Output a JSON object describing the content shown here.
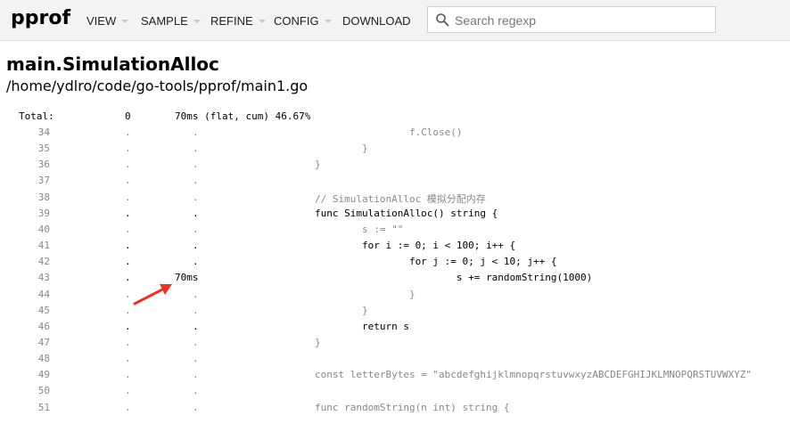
{
  "app": {
    "logo": "pprof"
  },
  "menu": {
    "view": "VIEW",
    "sample": "SAMPLE",
    "refine": "REFINE",
    "config": "CONFIG",
    "download": "DOWNLOAD"
  },
  "search": {
    "placeholder": "Search regexp",
    "value": ""
  },
  "function": {
    "name": "main.SimulationAlloc",
    "file": "/home/ydlro/code/go-tools/pprof/main1.go"
  },
  "total": {
    "label": "Total:",
    "flat": "0",
    "cum": "70ms (flat, cum) 46.67%"
  },
  "lines": [
    {
      "n": "34",
      "flat": ".",
      "cum": ".",
      "src": "                        f.Close()",
      "hot": false
    },
    {
      "n": "35",
      "flat": ".",
      "cum": ".",
      "src": "                }",
      "hot": false
    },
    {
      "n": "36",
      "flat": ".",
      "cum": ".",
      "src": "        }",
      "hot": false
    },
    {
      "n": "37",
      "flat": ".",
      "cum": ".",
      "src": "",
      "hot": false
    },
    {
      "n": "38",
      "flat": ".",
      "cum": ".",
      "src": "        // SimulationAlloc 模拟分配内存",
      "hot": false
    },
    {
      "n": "39",
      "flat": ".",
      "cum": ".",
      "src": "        func SimulationAlloc() string {",
      "hot": true
    },
    {
      "n": "40",
      "flat": ".",
      "cum": ".",
      "src": "                s := \"\"",
      "hot": false
    },
    {
      "n": "41",
      "flat": ".",
      "cum": ".",
      "src": "                for i := 0; i < 100; i++ {",
      "hot": true
    },
    {
      "n": "42",
      "flat": ".",
      "cum": ".",
      "src": "                        for j := 0; j < 10; j++ {",
      "hot": true
    },
    {
      "n": "43",
      "flat": ".",
      "cum": "70ms",
      "src": "                                s += randomString(1000)",
      "hot": true
    },
    {
      "n": "44",
      "flat": ".",
      "cum": ".",
      "src": "                        }",
      "hot": false
    },
    {
      "n": "45",
      "flat": ".",
      "cum": ".",
      "src": "                }",
      "hot": false
    },
    {
      "n": "46",
      "flat": ".",
      "cum": ".",
      "src": "                return s",
      "hot": true
    },
    {
      "n": "47",
      "flat": ".",
      "cum": ".",
      "src": "        }",
      "hot": false
    },
    {
      "n": "48",
      "flat": ".",
      "cum": ".",
      "src": "",
      "hot": false
    },
    {
      "n": "49",
      "flat": ".",
      "cum": ".",
      "src": "        const letterBytes = \"abcdefghijklmnopqrstuvwxyzABCDEFGHIJKLMNOPQRSTUVWXYZ\"",
      "hot": false
    },
    {
      "n": "50",
      "flat": ".",
      "cum": ".",
      "src": "",
      "hot": false
    },
    {
      "n": "51",
      "flat": ".",
      "cum": ".",
      "src": "        func randomString(n int) string {",
      "hot": false
    }
  ],
  "colors": {
    "arrow": "#e8352a",
    "header_bg": "#f3f3f3"
  }
}
